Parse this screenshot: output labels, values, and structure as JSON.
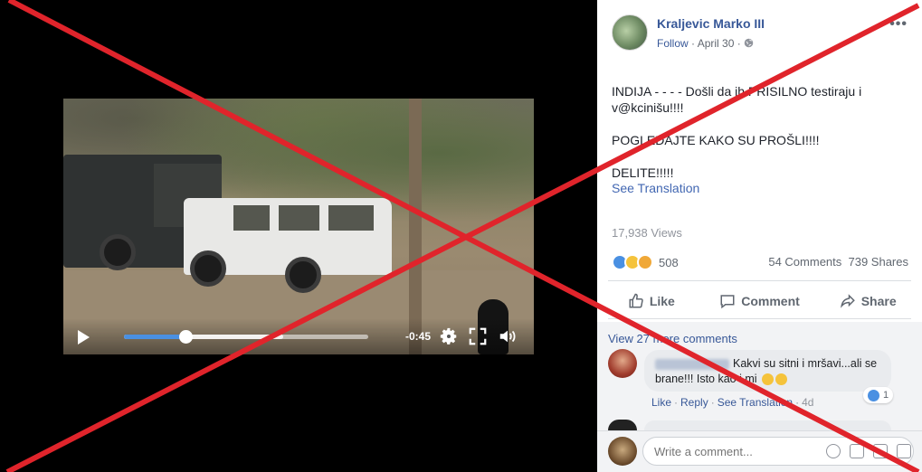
{
  "video": {
    "time_remaining": "-0:45",
    "progress": 0.25,
    "buffered": 0.65,
    "play_icon": "play-icon",
    "settings_icon": "gear-icon",
    "fullscreen_icon": "fullscreen-icon",
    "volume_icon": "volume-icon",
    "accent_color": "#4a90e2"
  },
  "post": {
    "author": "Kraljevic Marko III",
    "follow_label": "Follow",
    "separator": "·",
    "date": "April 30",
    "privacy_icon": "globe-icon",
    "more_icon": "more-options-icon",
    "more_label": "•••",
    "text_lines": [
      "INDIJA - - - - Došli da ih PRISILNO testiraju i v@kcinišu!!!!",
      "POGLEDAJTE KAKO SU PROŠLI!!!!",
      "DELITE!!!!!"
    ],
    "see_translation": "See Translation",
    "views": "17,938 Views",
    "reaction_count": "508",
    "comments_count": "54 Comments",
    "shares_count": "739 Shares",
    "actions": {
      "like": "Like",
      "comment": "Comment",
      "share": "Share"
    }
  },
  "comments": {
    "view_more": "View 27 more comments",
    "first": {
      "text": "Kakvi su sitni i mršavi...ali se brane!!! Isto kao i mi",
      "like_count": "1",
      "like": "Like",
      "reply": "Reply",
      "see_translation": "See Translation",
      "time": "4d"
    },
    "composer_placeholder": "Write a comment..."
  },
  "overlay": {
    "color": "#e0242b"
  }
}
